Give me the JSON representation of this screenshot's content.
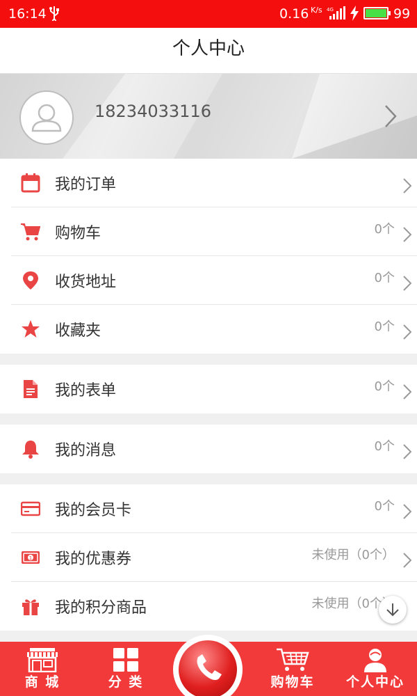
{
  "status_bar": {
    "time": "16:14",
    "net_speed": "0.16",
    "net_speed_unit": "K/s",
    "network": "4G",
    "battery_level": "99",
    "battery_percent": 99
  },
  "header": {
    "title": "个人中心"
  },
  "profile": {
    "phone": "18234033116"
  },
  "menu": {
    "orders": {
      "label": "我的订单",
      "icon": "calendar-icon"
    },
    "cart": {
      "label": "购物车",
      "count": "0个",
      "icon": "cart-icon"
    },
    "address": {
      "label": "收货地址",
      "count": "0个",
      "icon": "location-pin-icon"
    },
    "favorites": {
      "label": "收藏夹",
      "count": "0个",
      "icon": "star-icon"
    },
    "forms": {
      "label": "我的表单",
      "count": "0个",
      "icon": "document-icon"
    },
    "messages": {
      "label": "我的消息",
      "count": "0个",
      "icon": "bell-icon"
    },
    "membership": {
      "label": "我的会员卡",
      "count": "0个",
      "icon": "card-icon"
    },
    "coupons": {
      "label": "我的优惠券",
      "count": "未使用（0个）",
      "icon": "money-icon"
    },
    "points": {
      "label": "我的积分商品",
      "count": "未使用（0个）",
      "icon": "gift-icon"
    }
  },
  "tab_bar": {
    "shop": "商 城",
    "category": "分 类",
    "cart": "购物车",
    "profile": "个人中心"
  },
  "colors": {
    "accent": "#f23a3a",
    "status_bar": "#f40e0e",
    "icon_red": "#e94545",
    "muted_text": "#999999"
  }
}
